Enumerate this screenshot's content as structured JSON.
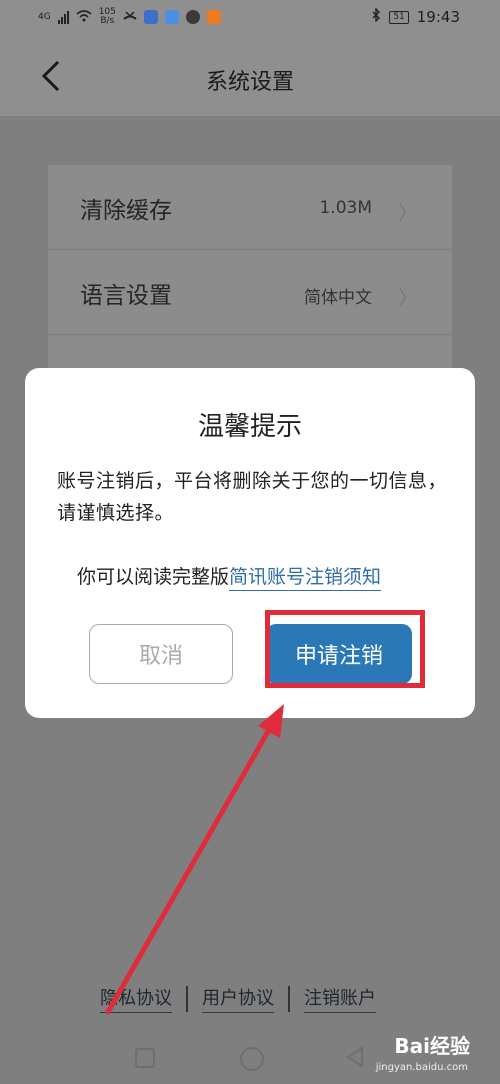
{
  "status_bar": {
    "net_type": "4G",
    "net_speed_value": "105",
    "net_speed_unit": "B/s",
    "battery": "51",
    "time": "19:43"
  },
  "header": {
    "title": "系统设置"
  },
  "settings": [
    {
      "label": "清除缓存",
      "value": "1.03M"
    },
    {
      "label": "语言设置",
      "value": "简体中文"
    }
  ],
  "dialog": {
    "title": "温馨提示",
    "body": "账号注销后，平台将删除关于您的一切信息，请谨慎选择。",
    "read_prefix": "你可以阅读完整版",
    "read_link": "简讯账号注销须知",
    "cancel_label": "取消",
    "apply_label": "申请注销"
  },
  "footer_links": {
    "privacy": "隐私协议",
    "user": "用户协议",
    "cancel_account": "注销账户"
  },
  "watermark": {
    "brand": "Bai经验",
    "url": "jingyan.baidu.com"
  },
  "colors": {
    "primary": "#2b78b7",
    "annotation": "#e02b3a"
  }
}
